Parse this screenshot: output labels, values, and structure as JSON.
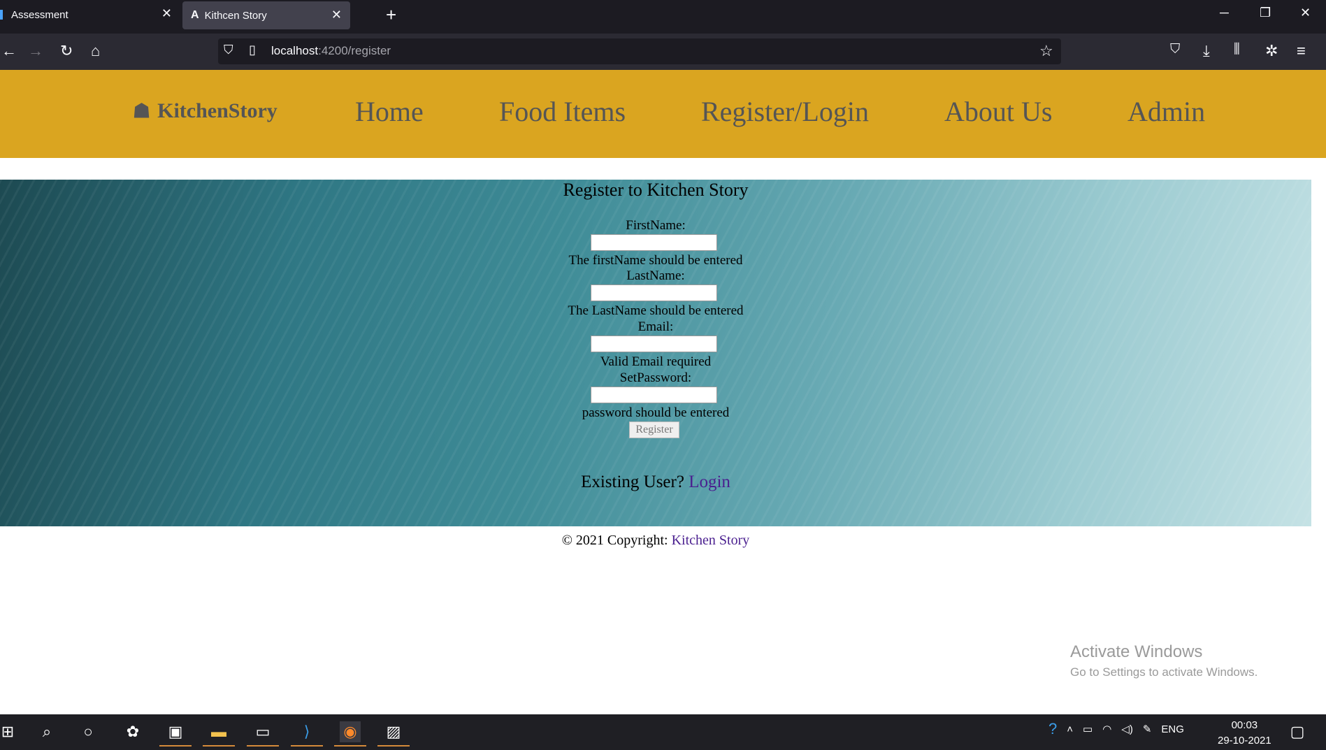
{
  "browser": {
    "tabs": [
      {
        "title": "Assessment",
        "active": false
      },
      {
        "title": "Kithcen Story",
        "active": true
      }
    ],
    "url_host": "localhost",
    "url_path": ":4200/register"
  },
  "site": {
    "brand": "KitchenStory",
    "nav": [
      "Home",
      "Food Items",
      "Register/Login",
      "About Us",
      "Admin"
    ],
    "accent_color": "#daa520"
  },
  "form": {
    "title": "Register to Kitchen Story",
    "fields": [
      {
        "label": "FirstName:",
        "value": "",
        "error": "The firstName should be entered"
      },
      {
        "label": "LastName:",
        "value": "",
        "error": "The LastName should be entered"
      },
      {
        "label": "Email:",
        "value": "",
        "error": "Valid Email required"
      },
      {
        "label": "SetPassword:",
        "value": "",
        "error": "password should be entered"
      }
    ],
    "submit_label": "Register",
    "existing_user_text": "Existing User?",
    "login_link": "Login"
  },
  "footer": {
    "text": "© 2021 Copyright:",
    "link": "Kitchen Story"
  },
  "watermark": {
    "line1": "Activate Windows",
    "line2": "Go to Settings to activate Windows."
  },
  "taskbar": {
    "lang": "ENG",
    "time": "00:03",
    "date": "29-10-2021"
  }
}
